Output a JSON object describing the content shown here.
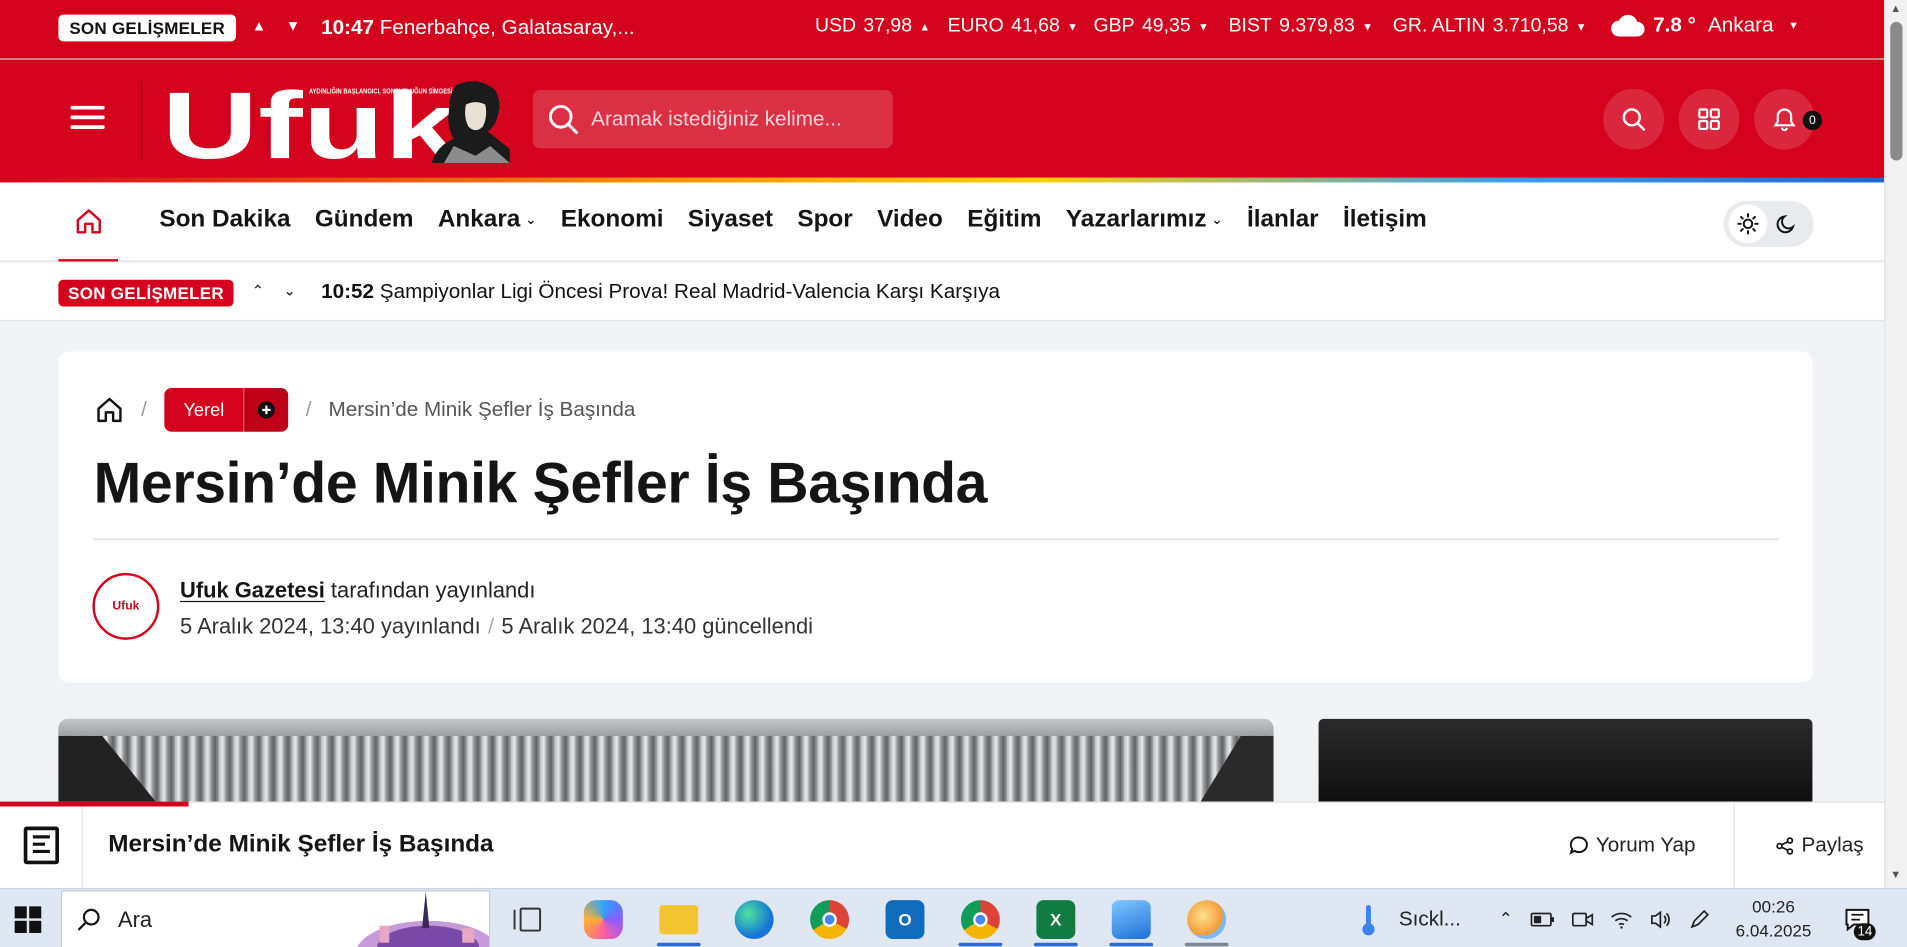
{
  "ticker": {
    "label": "SON GELİŞMELER",
    "time": "10:47",
    "headline": "Fenerbahçe, Galatasaray,..."
  },
  "markets": [
    {
      "name": "USD",
      "value": "37,98",
      "trend": "up"
    },
    {
      "name": "EURO",
      "value": "41,68",
      "trend": "down"
    },
    {
      "name": "GBP",
      "value": "49,35",
      "trend": "down"
    },
    {
      "name": "BIST",
      "value": "9.379,83",
      "trend": "down"
    },
    {
      "name": "GR. ALTIN",
      "value": "3.710,58",
      "trend": "down"
    }
  ],
  "weather": {
    "temp": "7.8 °",
    "city": "Ankara"
  },
  "header": {
    "logo_text": "Ufuk",
    "logo_tagline": "AYDINLIĞIN BAŞLANGICI, SONSUZLUĞUN SİMGESİ",
    "search_placeholder": "Aramak istediğiniz kelime...",
    "notification_count": "0"
  },
  "nav": {
    "items": [
      "Son Dakika",
      "Gündem",
      "Ankara",
      "Ekonomi",
      "Siyaset",
      "Spor",
      "Video",
      "Eğitim",
      "Yazarlarımız",
      "İlanlar",
      "İletişim"
    ]
  },
  "breaking": {
    "label": "SON GELİŞMELER",
    "time": "10:52",
    "headline": "Şampiyonlar Ligi Öncesi Prova! Real Madrid-Valencia Karşı Karşıya"
  },
  "article": {
    "category": "Yerel",
    "breadcrumb_title": "Mersin’de Minik Şefler İş Başında",
    "title": "Mersin’de Minik Şefler İş Başında",
    "author": "Ufuk Gazetesi",
    "byline_suffix": "tarafından yayınlandı",
    "avatar_text": "Ufuk",
    "published": "5 Aralık 2024, 13:40 yayınlandı",
    "updated": "5 Aralık 2024, 13:40 güncellendi"
  },
  "sticky": {
    "title": "Mersin’de Minik Şefler İş Başında",
    "comment": "Yorum Yap",
    "share": "Paylaş",
    "reading_progress": 0.1
  },
  "taskbar": {
    "search_placeholder": "Ara",
    "weather_text": "Sıckl...",
    "time": "00:26",
    "date": "6.04.2025",
    "notifications": "14"
  }
}
